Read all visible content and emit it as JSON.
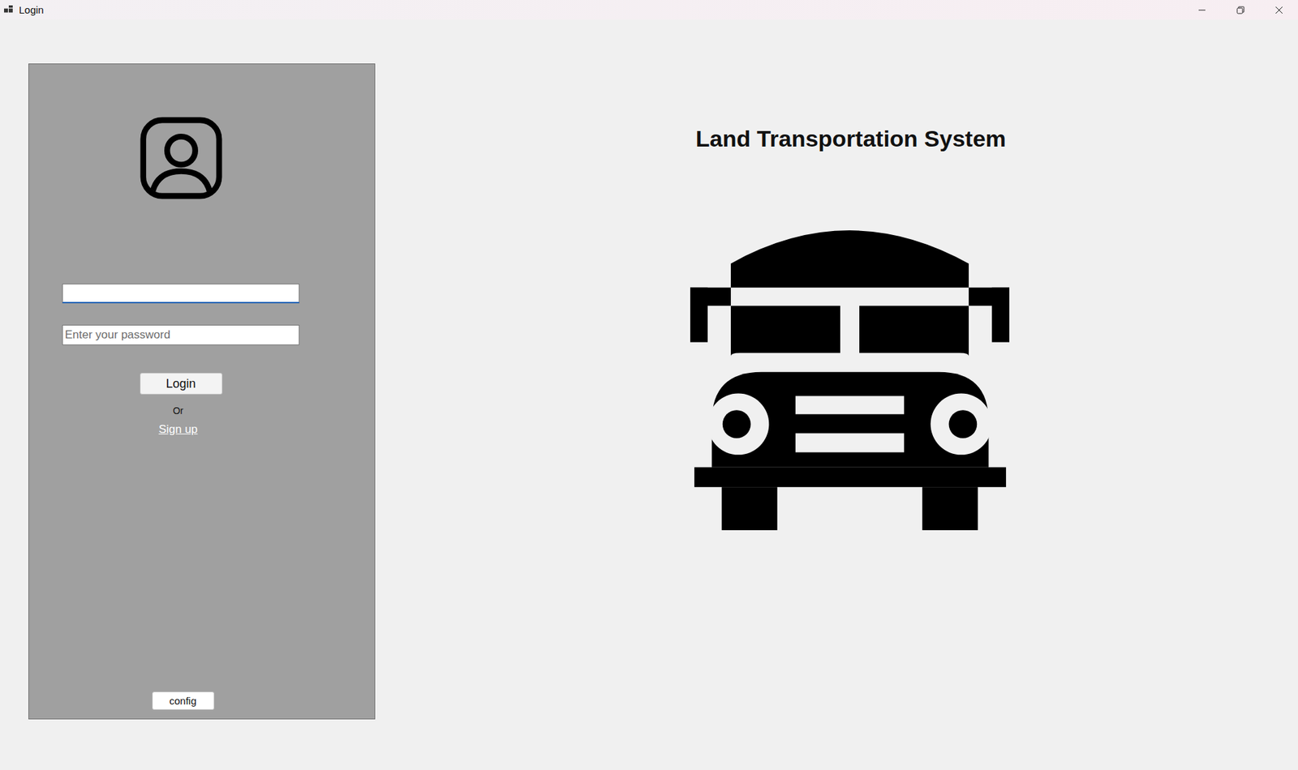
{
  "window": {
    "title": "Login"
  },
  "app_title": "Land Transportation System",
  "username": {
    "value": "",
    "focused": true
  },
  "password": {
    "value": "",
    "placeholder": "Enter your password",
    "focused": false
  },
  "login_button": "Login",
  "separator": "Or",
  "signup_link": "Sign up",
  "config_button": "config"
}
